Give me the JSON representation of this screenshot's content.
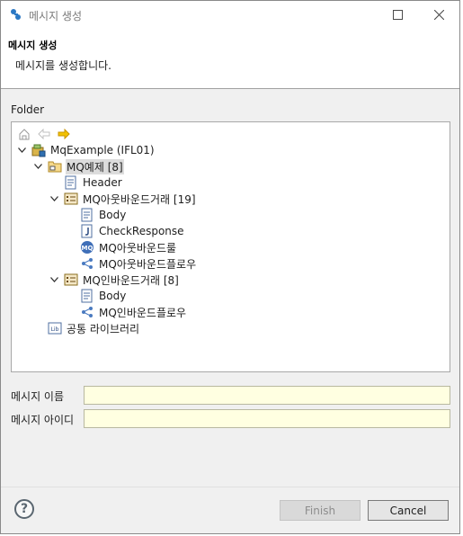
{
  "window": {
    "title": "메시지 생성"
  },
  "header": {
    "title": "메시지 생성",
    "description": "메시지를 생성합니다."
  },
  "folder": {
    "label": "Folder"
  },
  "tree": [
    {
      "label": "MqExample  (IFL01)",
      "icon": "project-icon",
      "expanded": true,
      "selected": false
    },
    {
      "label": "MQ예제 [8]",
      "icon": "folder-icon",
      "expanded": true,
      "selected": true
    },
    {
      "label": "Header",
      "icon": "document-icon",
      "expanded": null,
      "selected": false
    },
    {
      "label": "MQ아웃바운드거래 [19]",
      "icon": "transaction-icon",
      "expanded": true,
      "selected": false
    },
    {
      "label": "Body",
      "icon": "document-icon",
      "expanded": null,
      "selected": false
    },
    {
      "label": "CheckResponse",
      "icon": "script-icon",
      "expanded": null,
      "selected": false
    },
    {
      "label": "MQ아웃바운드룰",
      "icon": "mq-rule-icon",
      "expanded": null,
      "selected": false
    },
    {
      "label": "MQ아웃바운드플로우",
      "icon": "flow-icon",
      "expanded": null,
      "selected": false
    },
    {
      "label": "MQ인바운드거래 [8]",
      "icon": "transaction-icon",
      "expanded": true,
      "selected": false
    },
    {
      "label": "Body",
      "icon": "document-icon",
      "expanded": null,
      "selected": false
    },
    {
      "label": "MQ인바운드플로우",
      "icon": "flow-icon",
      "expanded": null,
      "selected": false
    },
    {
      "label": "공통 라이브러리",
      "icon": "library-icon",
      "expanded": null,
      "selected": false
    }
  ],
  "fields": {
    "message_name": {
      "label": "메시지 이름",
      "value": ""
    },
    "message_id": {
      "label": "메시지 아이디",
      "value": ""
    }
  },
  "buttons": {
    "finish": "Finish",
    "cancel": "Cancel",
    "help": "?"
  },
  "colors": {
    "input_background": "#ffffe1",
    "selection": "#dcdcdc",
    "accent_orange": "#e8a000"
  }
}
